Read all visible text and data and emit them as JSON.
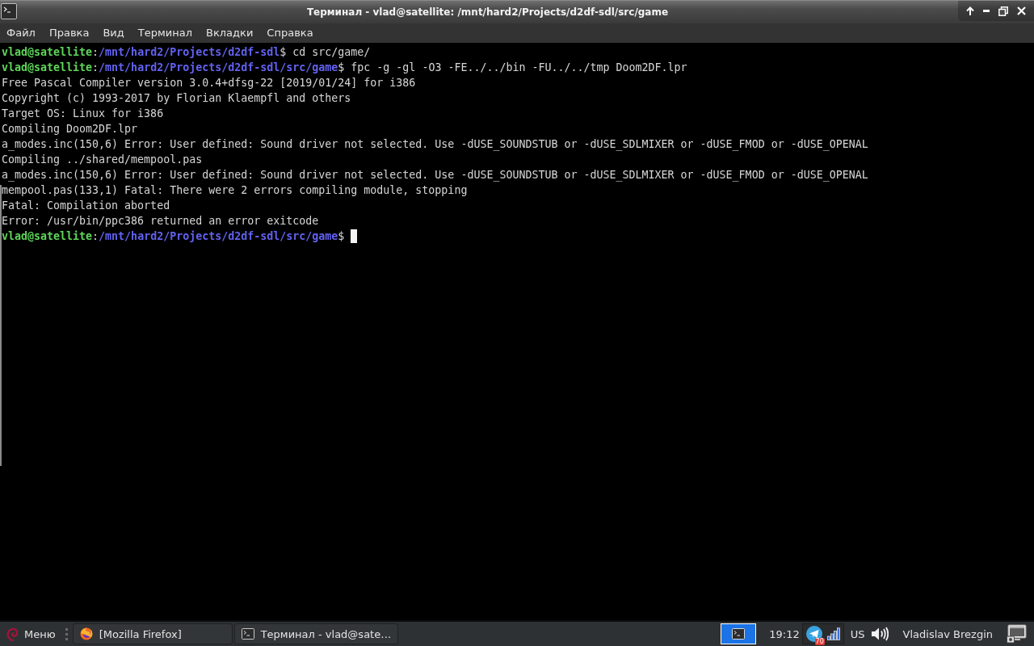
{
  "window": {
    "title": "Терминал - vlad@satellite: /mnt/hard2/Projects/d2df-sdl/src/game"
  },
  "menu": [
    {
      "label": "Файл"
    },
    {
      "label": "Правка"
    },
    {
      "label": "Вид"
    },
    {
      "label": "Терминал"
    },
    {
      "label": "Вкладки"
    },
    {
      "label": "Справка"
    }
  ],
  "terminal": {
    "lines": [
      {
        "kind": "prompt",
        "user_host": "vlad@satellite",
        "separator": ":",
        "path": "/mnt/hard2/Projects/d2df-sdl",
        "symbol": "$",
        "command": "cd src/game/",
        "cursor": false
      },
      {
        "kind": "prompt",
        "user_host": "vlad@satellite",
        "separator": ":",
        "path": "/mnt/hard2/Projects/d2df-sdl/src/game",
        "symbol": "$",
        "command": "fpc -g -gl -O3 -FE../../bin -FU../../tmp Doom2DF.lpr",
        "cursor": false
      },
      {
        "kind": "output",
        "text": "Free Pascal Compiler version 3.0.4+dfsg-22 [2019/01/24] for i386"
      },
      {
        "kind": "output",
        "text": "Copyright (c) 1993-2017 by Florian Klaempfl and others"
      },
      {
        "kind": "output",
        "text": "Target OS: Linux for i386"
      },
      {
        "kind": "output",
        "text": "Compiling Doom2DF.lpr"
      },
      {
        "kind": "output",
        "text": "a_modes.inc(150,6) Error: User defined: Sound driver not selected. Use -dUSE_SOUNDSTUB or -dUSE_SDLMIXER or -dUSE_FMOD or -dUSE_OPENAL"
      },
      {
        "kind": "output",
        "text": "Compiling ../shared/mempool.pas"
      },
      {
        "kind": "output",
        "text": "a_modes.inc(150,6) Error: User defined: Sound driver not selected. Use -dUSE_SOUNDSTUB or -dUSE_SDLMIXER or -dUSE_FMOD or -dUSE_OPENAL"
      },
      {
        "kind": "output",
        "text": "mempool.pas(133,1) Fatal: There were 2 errors compiling module, stopping"
      },
      {
        "kind": "output",
        "text": "Fatal: Compilation aborted"
      },
      {
        "kind": "output",
        "text": "Error: /usr/bin/ppc386 returned an error exitcode"
      },
      {
        "kind": "prompt",
        "user_host": "vlad@satellite",
        "separator": ":",
        "path": "/mnt/hard2/Projects/d2df-sdl/src/game",
        "symbol": "$",
        "cursor": true
      }
    ]
  },
  "taskbar": {
    "menu_label": "Меню",
    "tasks": [
      {
        "kind": "browser",
        "label": "[Mozilla Firefox]"
      },
      {
        "kind": "terminal",
        "label": "Терминал - vlad@sate…"
      }
    ],
    "workspaces": [
      {
        "selected": true
      }
    ],
    "clock": "19:12",
    "messenger_badge": "70",
    "keyboard_layout": "US",
    "user": "Vladislav Brezgin"
  }
}
